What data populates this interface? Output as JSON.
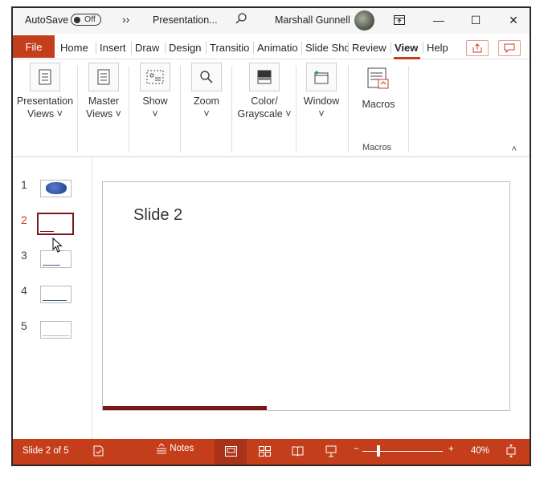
{
  "titlebar": {
    "autosave_label": "AutoSave",
    "autosave_state": "Off",
    "more_glyph": "››",
    "document_name": "Presentation...",
    "search_icon": "search-icon",
    "user_name": "Marshall Gunnell",
    "ribbon_display_glyph": "⊡",
    "minimize_glyph": "—",
    "maximize_glyph": "☐",
    "close_glyph": "✕"
  },
  "tabs": {
    "file": "File",
    "items": [
      "Home",
      "Insert",
      "Draw",
      "Design",
      "Transitio",
      "Animatio",
      "Slide Sho",
      "Review",
      "View",
      "Help"
    ],
    "active": "View",
    "share_icon": "share-icon",
    "comments_icon": "comment-icon"
  },
  "ribbon": {
    "presentation_views": {
      "line1": "Presentation",
      "line2": "Views ˅"
    },
    "master_views": {
      "line1": "Master",
      "line2": "Views ˅"
    },
    "show": {
      "line1": "Show",
      "line2": "˅"
    },
    "zoom": {
      "line1": "Zoom",
      "line2": "˅"
    },
    "color": {
      "line1": "Color/",
      "line2": "Grayscale ˅"
    },
    "window": {
      "line1": "Window",
      "line2": "˅"
    },
    "macros": {
      "line1": "Macros"
    },
    "macros_group": "Macros",
    "collapse_glyph": "˄"
  },
  "slides": {
    "numbers": [
      "1",
      "2",
      "3",
      "4",
      "5"
    ],
    "active_index": 2
  },
  "slide": {
    "title": "Slide 2"
  },
  "statusbar": {
    "slide_info": "Slide 2 of 5",
    "notes_label": "Notes",
    "zoom_minus": "−",
    "zoom_plus": "+",
    "zoom_level": "40%",
    "zoom_fraction": 0.4
  },
  "colors": {
    "accent": "#c43e1c",
    "slide_accent": "#7a1616"
  }
}
